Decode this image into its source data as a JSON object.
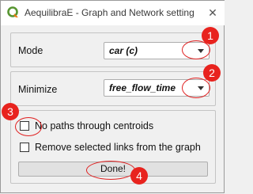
{
  "window": {
    "title": "AequilibraE - Graph and Network setting",
    "close_glyph": "✕"
  },
  "mode": {
    "label": "Mode",
    "selected": "car (c)"
  },
  "minimize": {
    "label": "Minimize",
    "selected": "free_flow_time"
  },
  "options": {
    "no_paths_label": "No paths through centroids",
    "no_paths_checked": false,
    "remove_links_label": "Remove selected links from the graph",
    "remove_links_checked": false
  },
  "done_button": {
    "label": "Done!"
  },
  "annotations": [
    {
      "number": "1"
    },
    {
      "number": "2"
    },
    {
      "number": "3"
    },
    {
      "number": "4"
    }
  ],
  "colors": {
    "annotation_red": "#e8231e",
    "qgis_green": "#589632",
    "qgis_yellow": "#ee7913"
  }
}
